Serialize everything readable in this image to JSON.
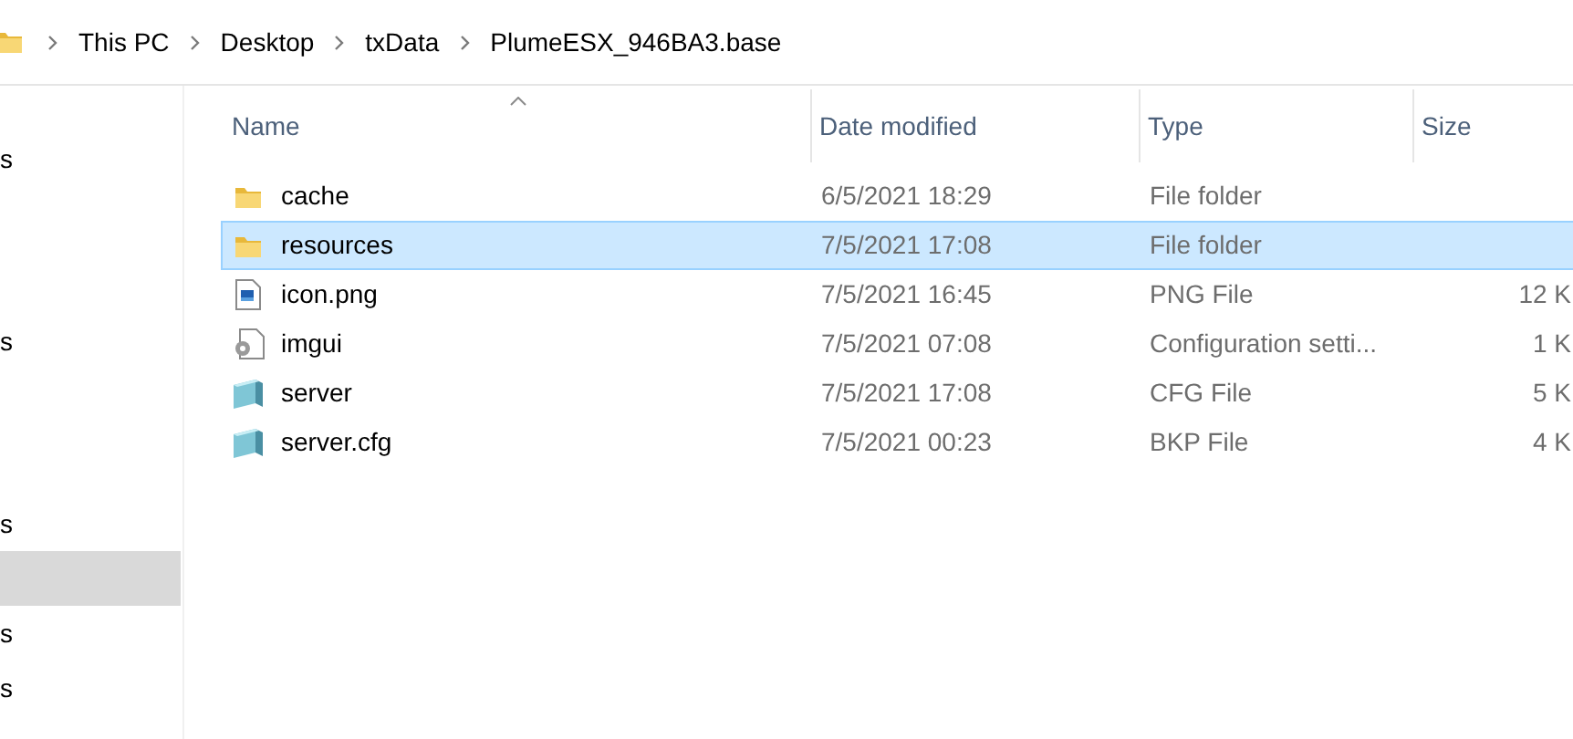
{
  "breadcrumb": [
    "This PC",
    "Desktop",
    "txData",
    "PlumeESX_946BA3.base"
  ],
  "sidebar": {
    "items": [
      {
        "label": "s",
        "selected": false
      },
      {
        "label": "s",
        "selected": false
      },
      {
        "label": "s",
        "selected": false
      },
      {
        "selected": true
      },
      {
        "label": "s",
        "selected": false
      },
      {
        "label": "s",
        "selected": false
      }
    ]
  },
  "table": {
    "columns": [
      {
        "label": "Name",
        "sorted": true
      },
      {
        "label": "Date modified",
        "sorted": false
      },
      {
        "label": "Type",
        "sorted": false
      },
      {
        "label": "Size",
        "sorted": false
      }
    ],
    "rows": [
      {
        "name": "cache",
        "kind": "folder",
        "date": "6/5/2021 18:29",
        "type": "File folder",
        "selected": false
      },
      {
        "name": "resources",
        "kind": "folder",
        "date": "7/5/2021 17:08",
        "type": "File folder",
        "selected": true
      },
      {
        "name": "icon.png",
        "kind": "image",
        "date": "7/5/2021 16:45",
        "type": "PNG File",
        "size": "12 K",
        "selected": false
      },
      {
        "name": "imgui",
        "kind": "settings",
        "date": "7/5/2021 07:08",
        "type": "Configuration setti...",
        "size": "1 K",
        "selected": false
      },
      {
        "name": "server",
        "kind": "config",
        "date": "7/5/2021 17:08",
        "type": "CFG File",
        "size": "5 K",
        "selected": false
      },
      {
        "name": "server.cfg",
        "kind": "config",
        "date": "7/5/2021 00:23",
        "type": "BKP File",
        "size": "4 K",
        "selected": false
      }
    ]
  }
}
